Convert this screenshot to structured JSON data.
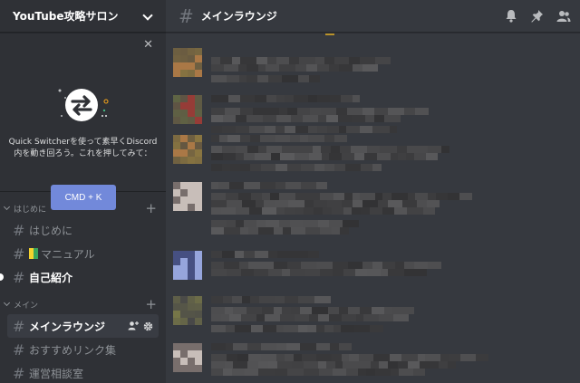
{
  "server": {
    "name": "YouTube攻略サロン"
  },
  "quick_switcher": {
    "text": "Quick Switcherを使って素早くDiscord内を動き回ろう。これを押してみて：",
    "button_label": "CMD + K"
  },
  "categories": [
    {
      "label": "はじめに",
      "channels": [
        {
          "name": "はじめに",
          "state": "normal"
        },
        {
          "name": "マニュアル",
          "state": "normal",
          "emoji": "beginner-mark"
        },
        {
          "name": "自己紹介",
          "state": "unread"
        }
      ]
    },
    {
      "label": "メイン",
      "channels": [
        {
          "name": "メインラウンジ",
          "state": "active"
        },
        {
          "name": "おすすめリンク集",
          "state": "normal"
        },
        {
          "name": "運営相談室",
          "state": "normal"
        }
      ]
    }
  ],
  "current_channel": {
    "name": "メインラウンジ"
  },
  "icons": {
    "notification": "bell-icon",
    "pinned": "pin-icon",
    "members": "members-icon",
    "invite": "add-member-icon",
    "settings": "gear-icon"
  },
  "colors": {
    "sidebar_bg": "#2f3136",
    "main_bg": "#36393f",
    "blurple": "#7289da",
    "active_channel_bg": "#393c43"
  }
}
